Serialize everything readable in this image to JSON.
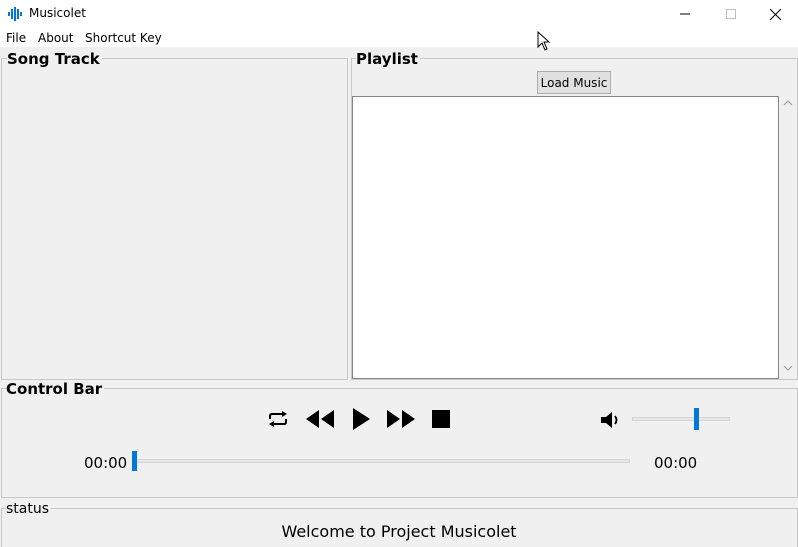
{
  "window": {
    "title": "Musicolet",
    "icons": {
      "app": "sound-wave-icon",
      "minimize": "minimize-icon",
      "maximize": "maximize-icon",
      "close": "close-icon"
    }
  },
  "menu": {
    "items": [
      "File",
      "About",
      "Shortcut Key"
    ]
  },
  "song_track": {
    "label": "Song Track"
  },
  "playlist": {
    "label": "Playlist",
    "load_button": "Load Music",
    "items": []
  },
  "control_bar": {
    "label": "Control Bar",
    "buttons": {
      "repeat": "repeat-icon",
      "rewind": "rewind-icon",
      "play": "play-icon",
      "fast_forward": "fast-forward-icon",
      "stop": "stop-icon"
    },
    "volume_icon": "volume-icon",
    "volume_level": 0.67,
    "current_time": "00:00",
    "total_time": "00:00",
    "seek_position": 0
  },
  "status": {
    "label": "status",
    "message": "Welcome to Project Musicolet"
  },
  "colors": {
    "accent": "#0078d7",
    "window_bg": "#f0f0f0",
    "list_bg": "#ffffff"
  }
}
